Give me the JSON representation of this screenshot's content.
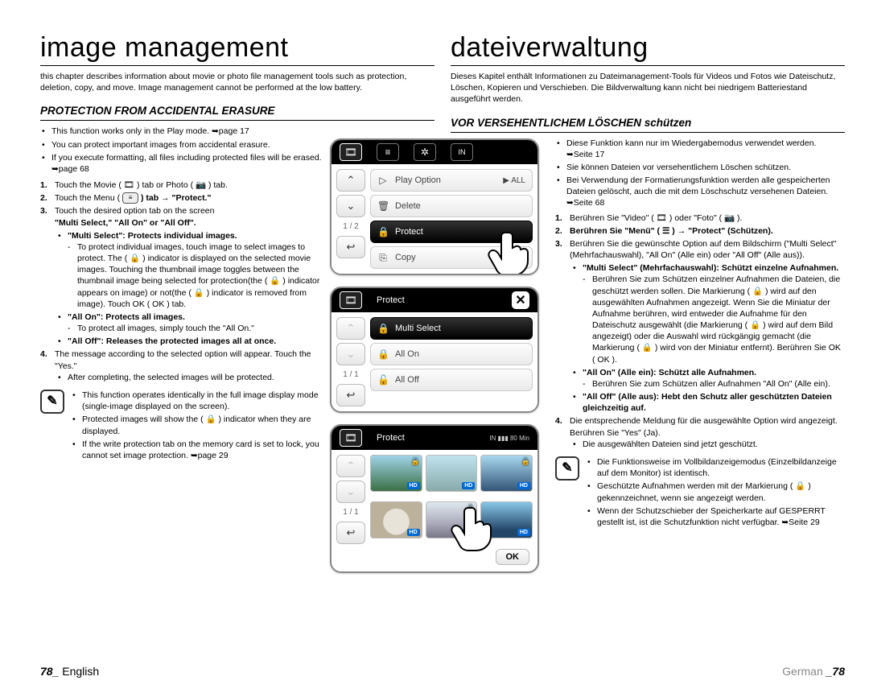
{
  "left": {
    "title": "image management",
    "intro": "this chapter describes information about movie or photo file management tools such as protection, deletion, copy, and move. Image management cannot be performed at the low battery.",
    "section": "PROTECTION FROM ACCIDENTAL ERASURE",
    "b1": "This function works only in the Play mode. ➥page 17",
    "b2": "You can protect important images from accidental erasure.",
    "b3": "If you execute formatting, all files including protected files will be erased. ➥page 68",
    "s1": "Touch the Movie ( 🎞 ) tab or Photo ( 📷 ) tab.",
    "s2a": "Touch the Menu ( ",
    "s2b": " ) tab → \"Protect.\"",
    "s3": "Touch the desired option tab on the screen",
    "s3opts": "\"Multi Select,\" \"All On\" or \"All Off\".",
    "ms_t": "\"Multi Select\": Protects individual images.",
    "ms_d": "To protect individual images, touch image to select images to protect. The ( 🔒 ) indicator is displayed on the selected movie images. Touching the thumbnail image toggles between the thumbnail image being selected for protection(the ( 🔒 ) indicator appears on image) or not(the ( 🔒 ) indicator is removed from image). Touch OK ( OK ) tab.",
    "ao_t": "\"All On\": Protects all images.",
    "ao_d": "To protect all images, simply touch the \"All On.\"",
    "af_t": "\"All Off\": Releases the protected images all at once.",
    "s4": "The message according to the selected option will appear. Touch the \"Yes.\"",
    "s4b": "After completing, the selected images will be protected.",
    "n1": "This function operates identically in the full image display mode (single-image displayed on the screen).",
    "n2": "Protected images will show the ( 🔒 ) indicator when they are displayed.",
    "n3": "If the write protection tab on the memory card is set to lock, you cannot set image protection. ➥page 29",
    "footer_pg": "78_",
    "footer_lang": " English"
  },
  "right": {
    "title": "dateiverwaltung",
    "intro": "Dieses Kapitel enthält Informationen zu Dateimanagement-Tools für Videos und Fotos wie Dateischutz, Löschen, Kopieren und Verschieben. Die Bildverwaltung kann nicht bei niedrigem Batteriestand ausgeführt werden.",
    "section": "VOR VERSEHENTLICHEM LÖSCHEN schützen",
    "b1": "Diese Funktion kann nur im Wiedergabemodus verwendet werden. ➥Seite 17",
    "b2": "Sie können Dateien vor versehentlichem Löschen schützen.",
    "b3": "Bei Verwendung der Formatierungsfunktion werden alle gespeicherten Dateien gelöscht, auch die mit dem Löschschutz versehenen Dateien. ➥Seite 68",
    "s1": "Berühren Sie \"Video\" ( 🎞 ) oder \"Foto\" ( 📷 ).",
    "s2": "Berühren Sie \"Menü\" ( ☰ ) → \"Protect\" (Schützen).",
    "s3": "Berühren Sie die gewünschte Option auf dem Bildschirm (\"Multi Select\" (Mehrfachauswahl), \"All On\" (Alle ein) oder \"All Off\" (Alle aus)).",
    "ms_t": "\"Multi Select\" (Mehrfachauswahl): Schützt einzelne Aufnahmen.",
    "ms_d": "Berühren Sie zum Schützen einzelner Aufnahmen die Dateien, die geschützt werden sollen. Die Markierung ( 🔒 ) wird auf den ausgewählten Aufnahmen angezeigt. Wenn Sie die Miniatur der Aufnahme berühren, wird entweder die Aufnahme für den Dateischutz ausgewählt (die Markierung ( 🔒 ) wird auf dem Bild angezeigt) oder die Auswahl wird rückgängig gemacht (die Markierung ( 🔒 ) wird von der Miniatur entfernt). Berühren Sie OK ( OK ).",
    "ao_t": "\"All On\" (Alle ein): Schützt alle Aufnahmen.",
    "ao_d": "Berühren Sie zum Schützen aller Aufnahmen \"All On\" (Alle ein).",
    "af_t": "\"All Off\" (Alle aus): Hebt den Schutz aller geschützten Dateien gleichzeitig auf.",
    "s4": "Die entsprechende Meldung für die ausgewählte Option wird angezeigt. Berühren Sie \"Yes\" (Ja).",
    "s4b": "Die ausgewählten Dateien sind jetzt geschützt.",
    "n1": "Die Funktionsweise im Vollbildanzeigemodus (Einzelbildanzeige auf dem Monitor) ist identisch.",
    "n2": "Geschützte Aufnahmen werden mit der Markierung ( 🔒 ) gekennzeichnet, wenn sie angezeigt werden.",
    "n3": "Wenn der Schutzschieber der Speicherkarte auf GESPERRT gestellt ist, ist die Schutzfunktion nicht verfügbar. ➥Seite 29",
    "footer_lang": "German ",
    "footer_pg": "_78"
  },
  "screens": {
    "s1": {
      "row1": "Play Option",
      "row1tail": "▶ ALL",
      "row2": "Delete",
      "row3": "Protect",
      "row4": "Copy",
      "page": "1 / 2"
    },
    "s2": {
      "title": "Protect",
      "row1": "Multi Select",
      "row2": "All On",
      "row3": "All Off",
      "page": "1 / 1"
    },
    "s3": {
      "title": "Protect",
      "status": "IN  ▮▮▮  80 Min",
      "page": "1 / 1",
      "ok": "OK",
      "badge": "HD"
    }
  }
}
